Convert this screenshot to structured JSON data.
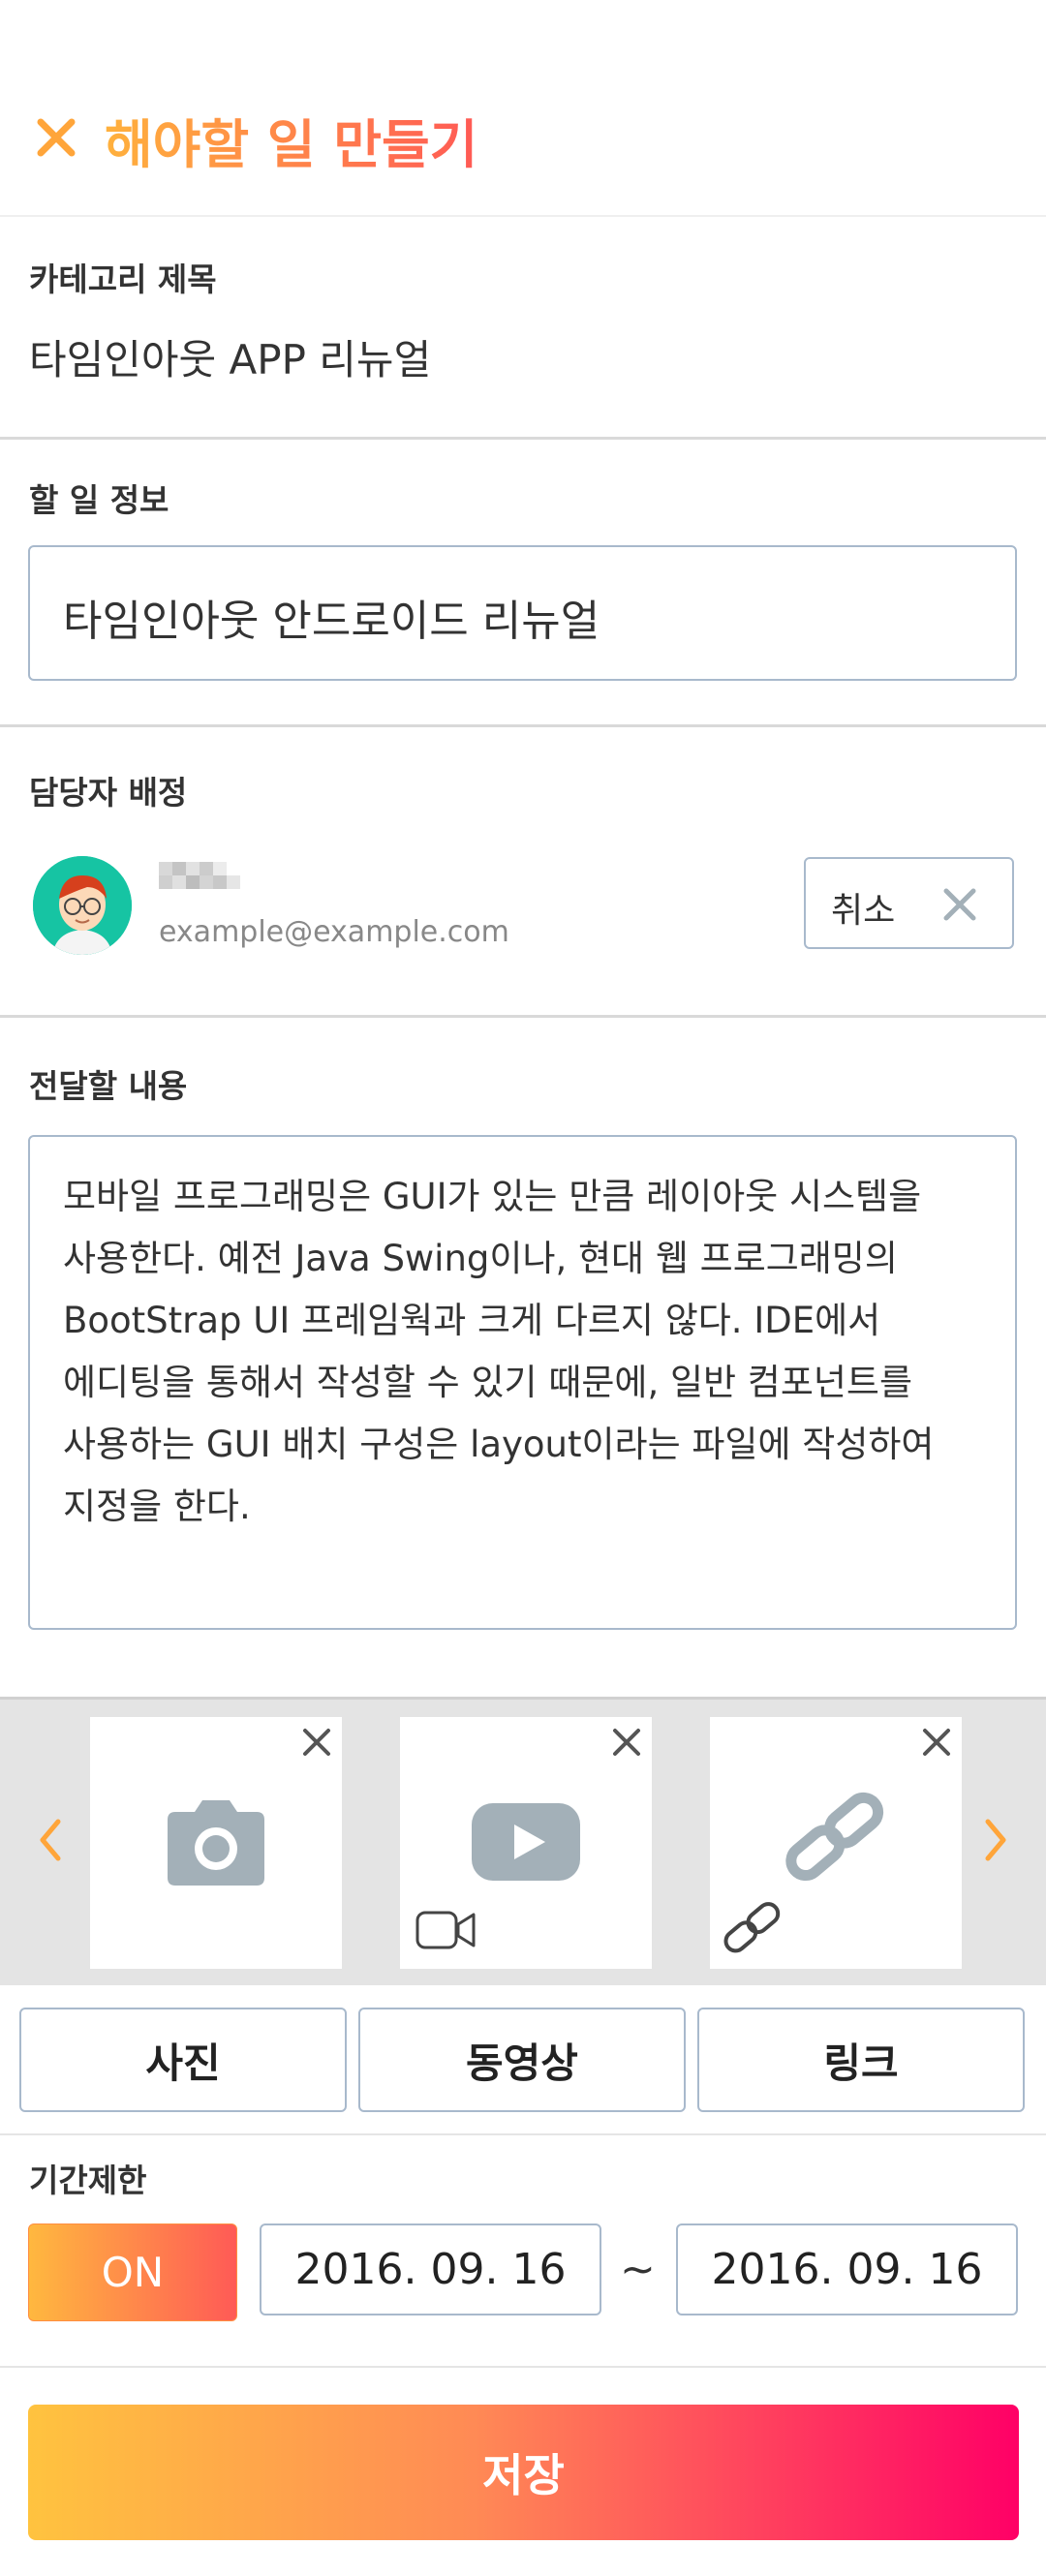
{
  "header": {
    "title": "해야할 일 만들기"
  },
  "category": {
    "label": "카테고리 제목",
    "value": "타임인아웃 APP 리뉴얼"
  },
  "task": {
    "label": "할 일 정보",
    "value": "타임인아웃 안드로이드 리뉴얼"
  },
  "assignee": {
    "label": "담당자 배정",
    "email": "example@example.com",
    "cancel_label": "취소"
  },
  "message": {
    "label": "전달할 내용",
    "lines": [
      "모바일 프로그래밍은 GUI가 있는 만큼 레이아웃 시스템을",
      "사용한다. 예전 Java Swing이나, 현대 웹 프로그래밍의",
      "BootStrap UI 프레임웍과 크게 다르지 않다. IDE에서",
      "에디팅을 통해서 작성할 수 있기 때문에, 일반 컴포넌트를",
      "사용하는 GUI 배치 구성은 layout이라는 파일에 작성하여",
      "지정을 한다."
    ]
  },
  "attachments": {
    "tiles": [
      "camera-icon",
      "video-icon",
      "link-icon"
    ],
    "buttons": {
      "photo": "사진",
      "video": "동영상",
      "link": "링크"
    }
  },
  "deadline": {
    "label": "기간제한",
    "toggle": "ON",
    "start": "2016. 09. 16",
    "separator": "~",
    "end": "2016. 09. 16"
  },
  "save_label": "저장",
  "colors": {
    "accent_start": "#ffb13d",
    "accent_end": "#ff0066",
    "border": "#a8b9cc",
    "icon_gray": "#a3b0b8"
  }
}
